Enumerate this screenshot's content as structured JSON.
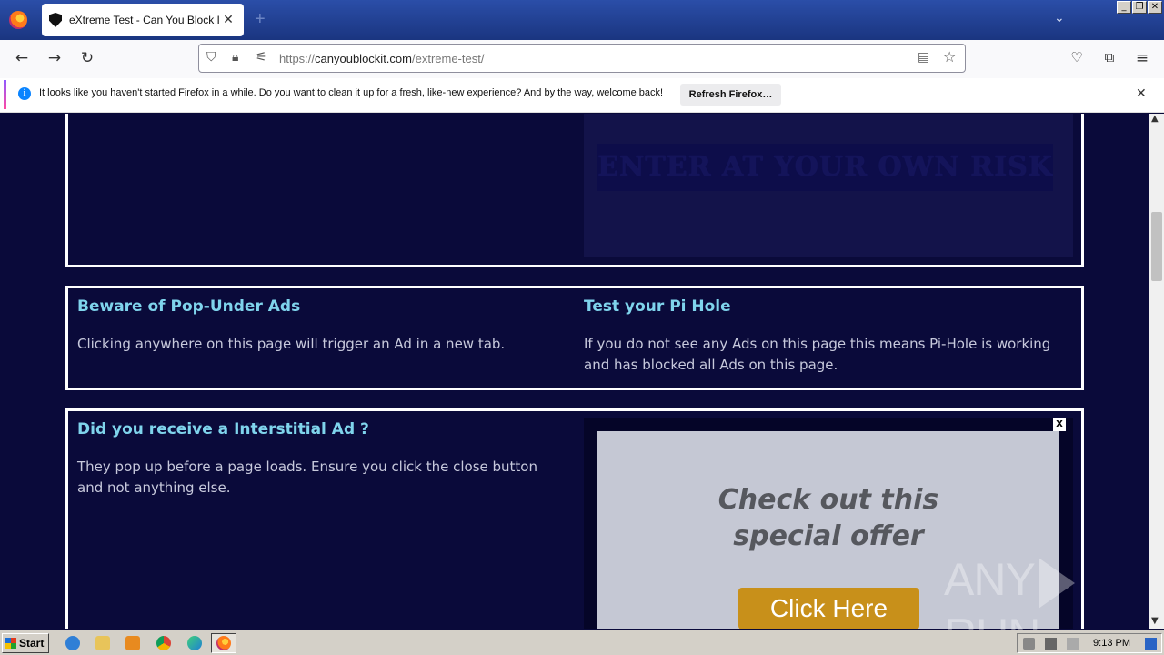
{
  "browser": {
    "tab_title": "eXtreme Test - Can You Block It ?",
    "tab_close": "✕",
    "new_tab": "+",
    "url_prefix": "https://",
    "url_host": "canyoublockit.com",
    "url_path": "/extreme-test/"
  },
  "notification": {
    "text": "It looks like you haven't started Firefox in a while. Do you want to clean it up for a fresh, like-new experience? And by the way, welcome back!",
    "button": "Refresh Firefox…",
    "close": "✕"
  },
  "page": {
    "risk_banner": "ENTER AT YOUR OWN RISK",
    "popunder": {
      "title": "Beware of Pop-Under Ads",
      "body": "Clicking anywhere on this page will trigger an Ad in a new tab."
    },
    "pihole": {
      "title": "Test your Pi Hole",
      "body": "If you do not see any Ads on this page this means Pi-Hole is working and has blocked all Ads on this page."
    },
    "interstitial": {
      "title": "Did you receive a Interstitial Ad ?",
      "body": "They pop up before a page loads. Ensure you click the close button and not anything else."
    },
    "ad": {
      "close": "X",
      "headline_line1": "Check out this",
      "headline_line2": "special offer",
      "button": "Click Here"
    }
  },
  "watermark": {
    "left": "ANY",
    "right": "RUN"
  },
  "taskbar": {
    "start": "Start",
    "clock": "9:13 PM"
  }
}
